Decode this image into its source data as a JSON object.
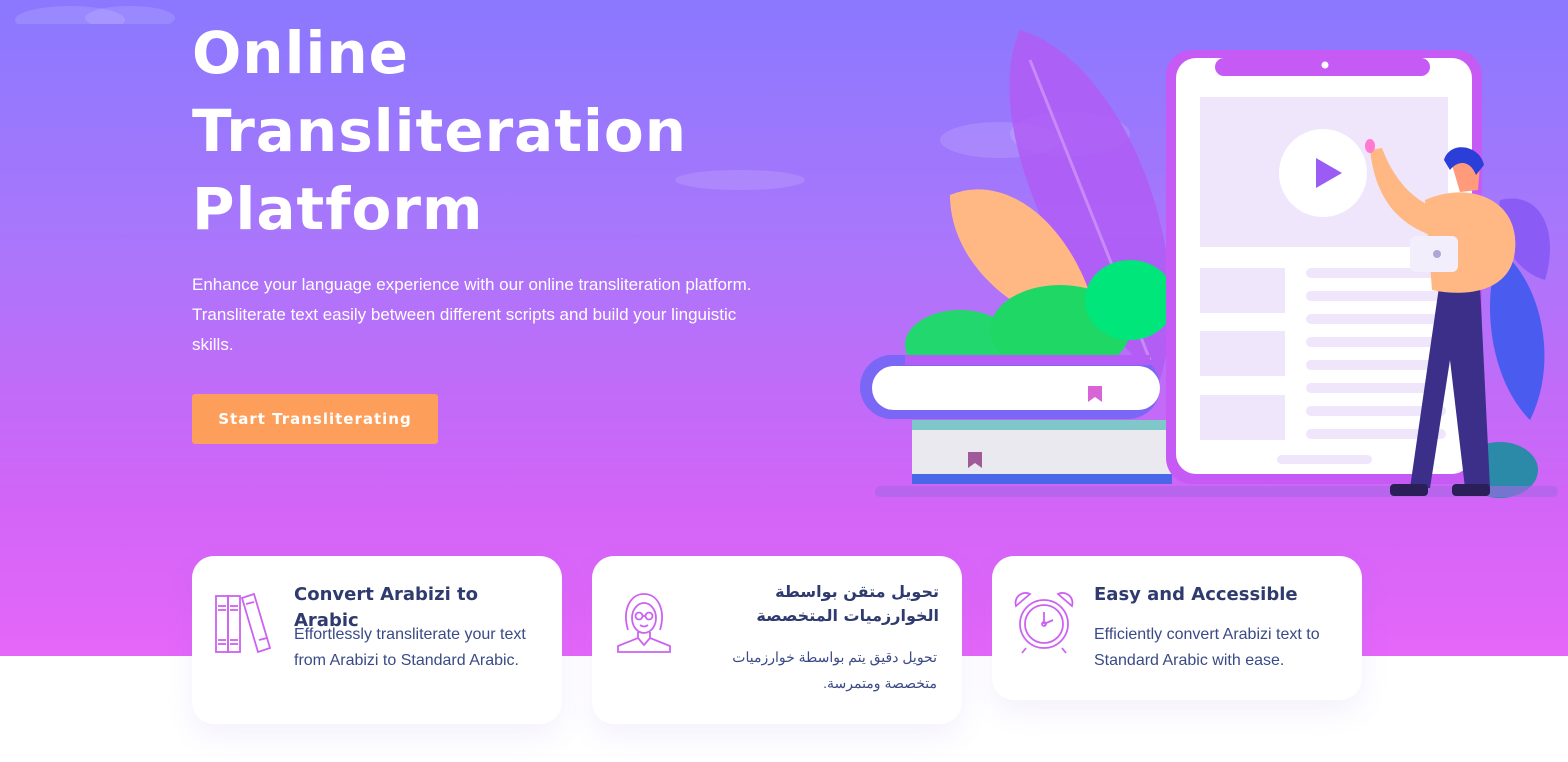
{
  "hero": {
    "title_lines": [
      "Online",
      "Transliteration",
      "Platform"
    ],
    "description": "Enhance your language experience with our online transliteration platform. Transliterate text easily between different scripts and build your linguistic skills.",
    "cta_label": "Start Transliterating"
  },
  "features": [
    {
      "icon": "books-icon",
      "title": "Convert Arabizi to Arabic",
      "text": "Effortlessly transliterate your text from Arabizi to Standard Arabic."
    },
    {
      "icon": "woman-with-glasses-icon",
      "title": "تحويل متقن بواسطة الخوارزميات المتخصصة",
      "text": "تحويل دقيق يتم بواسطة خوارزميات متخصصة ومتمرسة."
    },
    {
      "icon": "alarm-clock-icon",
      "title": "Easy and Accessible",
      "text": "Efficiently convert Arabizi text to Standard Arabic with ease."
    }
  ],
  "colors": {
    "gradient_top": "#8a78ff",
    "gradient_bottom": "#e567f9",
    "cta": "#fd9e5a",
    "heading": "#2f3b6e",
    "icon_stroke": "#cc63f0"
  }
}
